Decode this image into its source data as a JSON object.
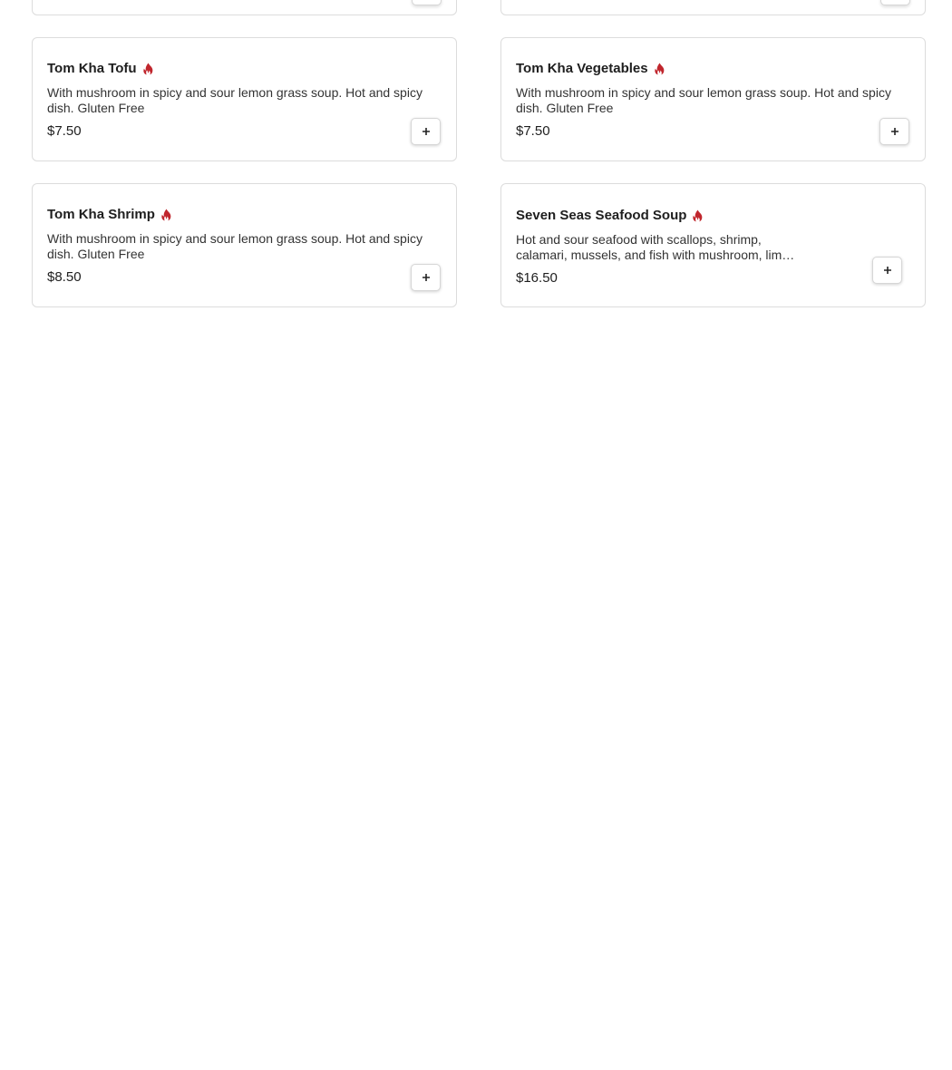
{
  "accent_color": "#c0262d",
  "items": [
    {
      "name": "Tom Kha Tofu",
      "spicy": true,
      "description": "With mushroom in spicy and sour lemon grass soup. Hot and spicy dish. Gluten Free",
      "price": "$7.50",
      "icon": "flame-icon",
      "add_icon": "plus-icon"
    },
    {
      "name": "Tom Kha Vegetables",
      "spicy": true,
      "description": "With mushroom in spicy and sour lemon grass soup. Hot and spicy dish. Gluten Free",
      "price": "$7.50",
      "icon": "flame-icon",
      "add_icon": "plus-icon"
    },
    {
      "name": "Tom Kha Shrimp",
      "spicy": true,
      "description": "With mushroom in spicy and sour lemon grass soup. Hot and spicy dish. Gluten Free",
      "price": "$8.50",
      "icon": "flame-icon",
      "add_icon": "plus-icon"
    },
    {
      "name": "Seven Seas Seafood Soup",
      "spicy": true,
      "description": "Hot and sour seafood with scallops, shrimp, calamari, mussels, and fish with mushroom, lim…",
      "price": "$16.50",
      "icon": "flame-icon",
      "add_icon": "plus-icon"
    }
  ]
}
